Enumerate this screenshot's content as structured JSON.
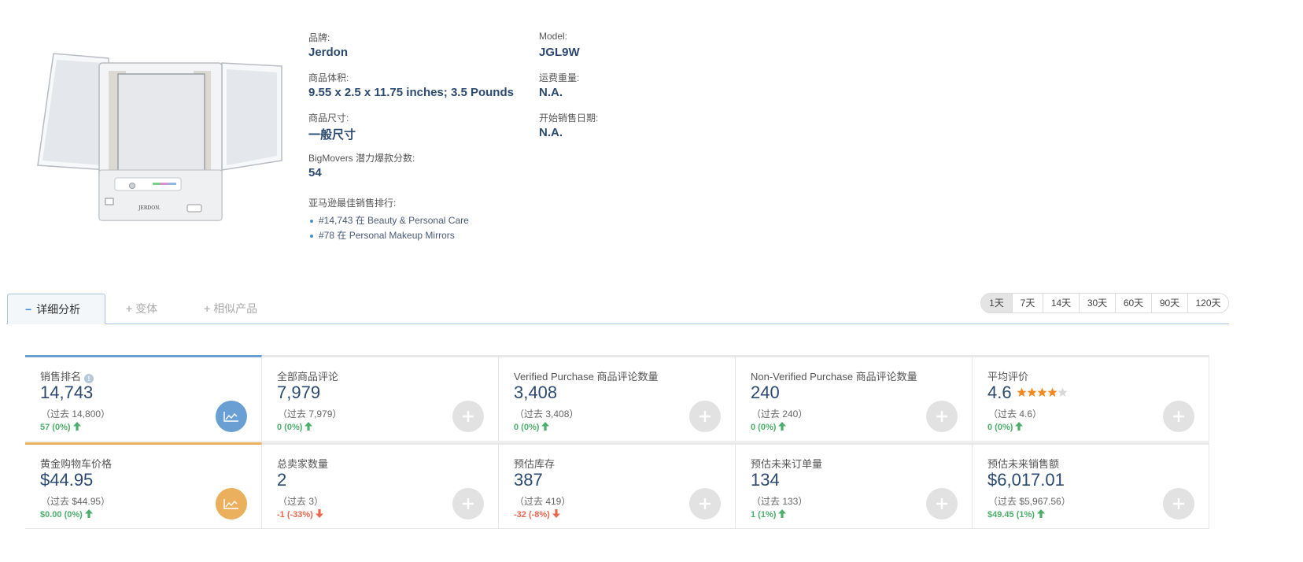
{
  "product": {
    "image_alt": "JERDON tri-fold lighted makeup mirror",
    "image_brand_text": "JERDON.",
    "fields": {
      "brand_label": "品牌:",
      "brand_value": "Jerdon",
      "model_label": "Model:",
      "model_value": "JGL9W",
      "volume_label": "商品体积:",
      "volume_value": "9.55 x 2.5 x 11.75 inches; 3.5 Pounds",
      "shipping_weight_label": "运费重量:",
      "shipping_weight_value": "N.A.",
      "size_label": "商品尺寸:",
      "size_value": "一般尺寸",
      "sale_date_label": "开始销售日期:",
      "sale_date_value": "N.A.",
      "bigmovers_label": "BigMovers 潜力爆款分数:",
      "bigmovers_value": "54",
      "bestseller_label": "亚马逊最佳销售排行:"
    },
    "ranks": [
      {
        "text": "#14,743 在 Beauty & Personal Care"
      },
      {
        "text": "#78 在 Personal Makeup Mirrors"
      }
    ]
  },
  "tabs": [
    {
      "label": "详细分析",
      "symbol": "−",
      "active": true
    },
    {
      "label": "变体",
      "symbol": "+",
      "active": false
    },
    {
      "label": "相似产品",
      "symbol": "+",
      "active": false
    }
  ],
  "day_ranges": [
    {
      "label": "1天",
      "active": true
    },
    {
      "label": "7天",
      "active": false
    },
    {
      "label": "14天",
      "active": false
    },
    {
      "label": "30天",
      "active": false
    },
    {
      "label": "60天",
      "active": false
    },
    {
      "label": "90天",
      "active": false
    },
    {
      "label": "120天",
      "active": false
    }
  ],
  "metrics": [
    {
      "title": "销售排名",
      "value": "14,743",
      "prev": "（过去 14,800）",
      "change": "57 (0%)",
      "direction": "up",
      "action": "chart",
      "color": "blue",
      "has_info": true
    },
    {
      "title": "全部商品评论",
      "value": "7,979",
      "prev": "（过去 7,979）",
      "change": "0 (0%)",
      "direction": "up",
      "action": "plus"
    },
    {
      "title": "Verified Purchase 商品评论数量",
      "value": "3,408",
      "prev": "（过去 3,408）",
      "change": "0 (0%)",
      "direction": "up",
      "action": "plus"
    },
    {
      "title": "Non-Verified Purchase 商品评论数量",
      "value": "240",
      "prev": "（过去 240）",
      "change": "0 (0%)",
      "direction": "up",
      "action": "plus"
    },
    {
      "title": "平均评价",
      "value": "4.6",
      "prev": "（过去 4.6）",
      "change": "0 (0%)",
      "direction": "up",
      "action": "plus",
      "stars": 4.5
    },
    {
      "title": "黄金购物车价格",
      "value": "$44.95",
      "prev": "（过去 $44.95）",
      "change": "$0.00 (0%)",
      "direction": "up",
      "action": "chart",
      "color": "orange"
    },
    {
      "title": "总卖家数量",
      "value": "2",
      "prev": "（过去 3）",
      "change": "-1 (-33%)",
      "direction": "down",
      "action": "plus"
    },
    {
      "title": "预估库存",
      "value": "387",
      "prev": "（过去 419）",
      "change": "-32 (-8%)",
      "direction": "down",
      "action": "plus"
    },
    {
      "title": "预估未来订单量",
      "value": "134",
      "prev": "（过去 133）",
      "change": "1 (1%)",
      "direction": "up",
      "action": "plus"
    },
    {
      "title": "预估未来销售额",
      "value": "$6,017.01",
      "prev": "（过去 $5,967.56）",
      "change": "$49.45 (1%)",
      "direction": "up",
      "action": "plus"
    }
  ],
  "colors": {
    "accent_blue": "#6a9fd4",
    "accent_orange": "#ebb05e",
    "up_green": "#4cae6a",
    "down_red": "#e9674f",
    "star_orange": "#f08a24"
  }
}
